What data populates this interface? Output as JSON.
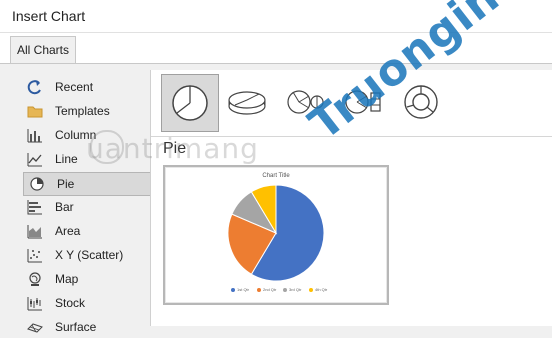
{
  "window": {
    "title": "Insert Chart"
  },
  "tabs": [
    {
      "label": "All Charts"
    }
  ],
  "nav": {
    "items": [
      {
        "label": "Recent",
        "icon": "recent-icon"
      },
      {
        "label": "Templates",
        "icon": "folder-icon"
      },
      {
        "label": "Column",
        "icon": "column-chart-icon"
      },
      {
        "label": "Line",
        "icon": "line-chart-icon"
      },
      {
        "label": "Pie",
        "icon": "pie-chart-icon",
        "selected": true
      },
      {
        "label": "Bar",
        "icon": "bar-chart-icon"
      },
      {
        "label": "Area",
        "icon": "area-chart-icon"
      },
      {
        "label": "X Y (Scatter)",
        "icon": "scatter-chart-icon"
      },
      {
        "label": "Map",
        "icon": "map-icon"
      },
      {
        "label": "Stock",
        "icon": "stock-chart-icon"
      },
      {
        "label": "Surface",
        "icon": "surface-chart-icon"
      }
    ]
  },
  "subtypes": [
    {
      "name": "pie",
      "selected": true
    },
    {
      "name": "3d-pie"
    },
    {
      "name": "pie-of-pie"
    },
    {
      "name": "bar-of-pie"
    },
    {
      "name": "doughnut"
    }
  ],
  "section": {
    "title": "Pie"
  },
  "chart_data": {
    "type": "pie",
    "title": "Chart Title",
    "categories": [
      "1st Qtr",
      "2nd Qtr",
      "3rd Qtr",
      "4th Qtr"
    ],
    "values": [
      8.2,
      3.2,
      1.4,
      1.2
    ],
    "colors": [
      "#4472c4",
      "#ed7d31",
      "#a5a5a5",
      "#ffc000"
    ]
  },
  "watermark": {
    "left_text": "uantrimang",
    "right_text": "Truongin.top"
  }
}
